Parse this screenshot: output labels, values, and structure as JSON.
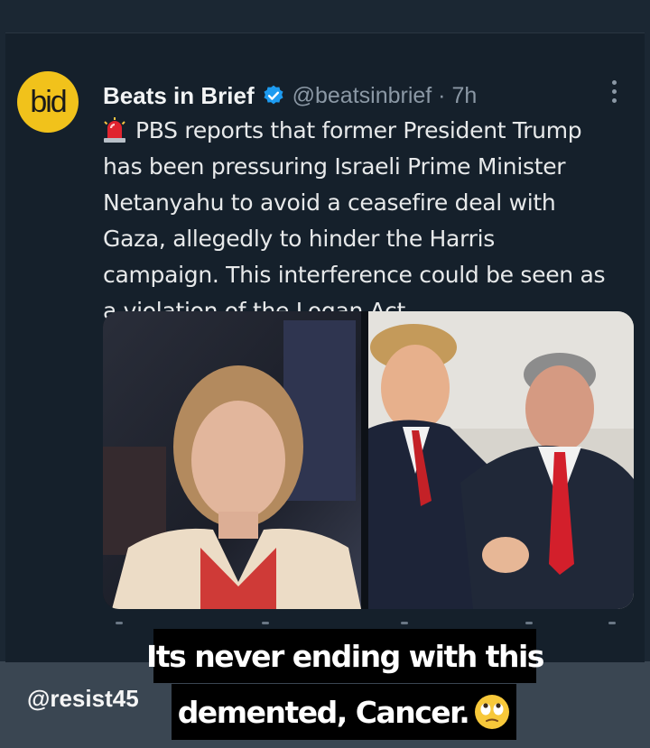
{
  "tweet": {
    "avatar_text": "bid",
    "display_name": "Beats in Brief",
    "handle_time": "@beatsinbrief · 7h",
    "text": "PBS reports that former President Trump has been pressuring Israeli Prime Minister Netanyahu to avoid a ceasefire deal with Gaza, allegedly to hinder the Harris campaign. This interference could be seen as a violation of the Logan Act."
  },
  "overlay": {
    "caption_line1": "Its never ending with this",
    "caption_line2": "demented, Cancer.",
    "emoji": "face-with-rolling-eyes",
    "watermark": "@resist45"
  },
  "colors": {
    "background": "#15202b",
    "text": "#e7e9ea",
    "muted": "#8b98a5",
    "verified": "#1d9bf0",
    "avatar": "#f1c21b"
  }
}
